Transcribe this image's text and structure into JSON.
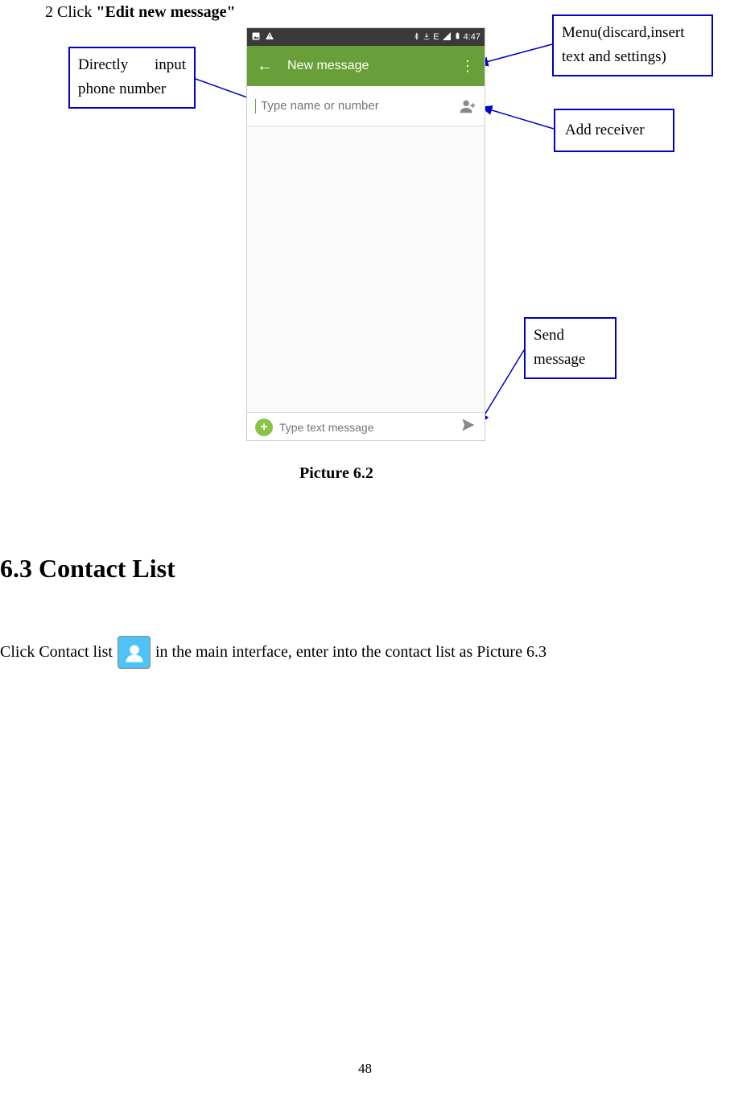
{
  "step": {
    "number": "2 Click ",
    "bold": "\"Edit new message\""
  },
  "callouts": {
    "directly": "Directly input phone number",
    "menu": "Menu(discard,insert text and settings)",
    "addreceiver": "Add receiver",
    "send": "Send message"
  },
  "phone": {
    "statusbar": {
      "time": "4:47",
      "net": "E"
    },
    "titlebar": {
      "title": "New message"
    },
    "recipient_placeholder": "Type name or number",
    "compose_placeholder": "Type text message"
  },
  "caption": "Picture 6.2",
  "section_heading": "6.3 Contact List",
  "paragraph": {
    "before": "Click Contact list",
    "after": " in the main interface, enter into the contact list as Picture 6.3"
  },
  "page_number": "48"
}
